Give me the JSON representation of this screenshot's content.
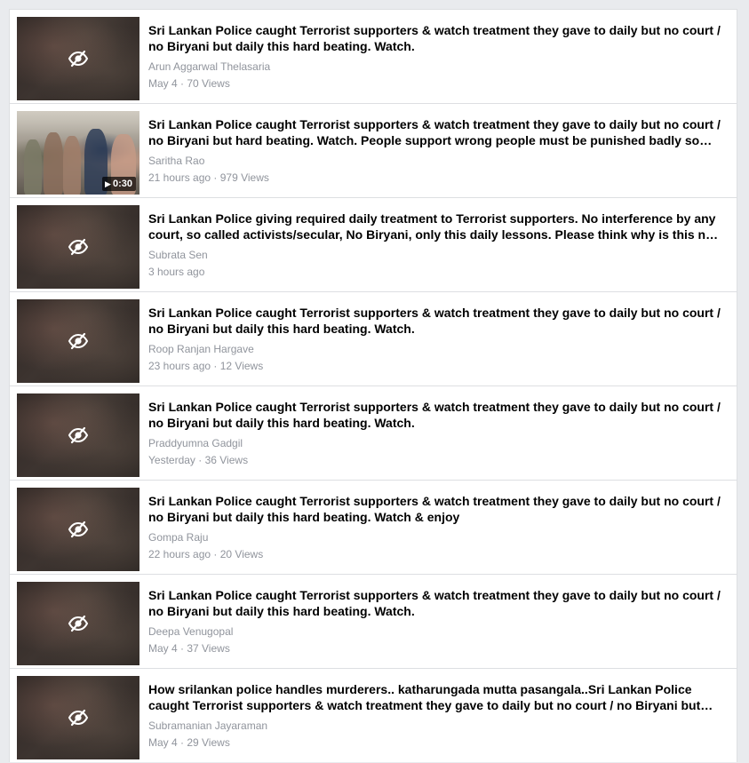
{
  "videos": [
    {
      "title": "Sri Lankan Police caught Terrorist supporters & watch treatment they gave to daily but no court / no Biryani but daily this hard beating. Watch.",
      "author": "Arun Aggarwal Thelasaria",
      "meta": "May 4 · 70 Views",
      "thumbnail": "hidden-sensitive",
      "duration": ""
    },
    {
      "title": "Sri Lankan Police caught Terrorist supporters & watch treatment they gave to daily but no court / no Biryani but hard beating. Watch. People support wrong people must be punished badly so…",
      "author": "Saritha Rao",
      "meta": "21 hours ago · 979 Views",
      "thumbnail": "photo",
      "duration": "0:30"
    },
    {
      "title": "Sri Lankan Police giving required daily treatment to Terrorist supporters. No interference by any court, so called activists/secular, No Biryani, only this daily lessons. Please think why is this n…",
      "author": "Subrata Sen",
      "meta": "3 hours ago",
      "thumbnail": "hidden-sensitive",
      "duration": ""
    },
    {
      "title": "Sri Lankan Police caught Terrorist supporters & watch treatment they gave to daily but no court / no Biryani but daily this hard beating. Watch.",
      "author": "Roop Ranjan Hargave",
      "meta": "23 hours ago · 12 Views",
      "thumbnail": "hidden-sensitive",
      "duration": ""
    },
    {
      "title": "Sri Lankan Police caught Terrorist supporters & watch treatment they gave to daily but no court / no Biryani but daily this hard beating. Watch.",
      "author": "Praddyumna Gadgil",
      "meta": "Yesterday · 36 Views",
      "thumbnail": "hidden-sensitive",
      "duration": ""
    },
    {
      "title": "Sri Lankan Police caught Terrorist supporters & watch treatment they gave to daily but no court / no Biryani but daily this hard beating. Watch & enjoy",
      "author": "Gompa Raju",
      "meta": "22 hours ago · 20 Views",
      "thumbnail": "hidden-sensitive",
      "duration": ""
    },
    {
      "title": "Sri Lankan Police caught Terrorist supporters & watch treatment they gave to daily but no court / no Biryani but daily this hard beating. Watch.",
      "author": "Deepa Venugopal",
      "meta": "May 4 · 37 Views",
      "thumbnail": "hidden-sensitive",
      "duration": ""
    },
    {
      "title": "How srilankan police handles murderers.. katharungada mutta pasangala..Sri Lankan Police caught Terrorist supporters & watch treatment they gave to daily but no court / no Biryani but…",
      "author": "Subramanian Jayaraman",
      "meta": "May 4 · 29 Views",
      "thumbnail": "hidden-sensitive",
      "duration": ""
    }
  ],
  "colors": {
    "page_bg": "#e9ebee",
    "card_bg": "#ffffff",
    "border": "#dddfe2",
    "title": "#000000",
    "secondary_text": "#90949c"
  }
}
